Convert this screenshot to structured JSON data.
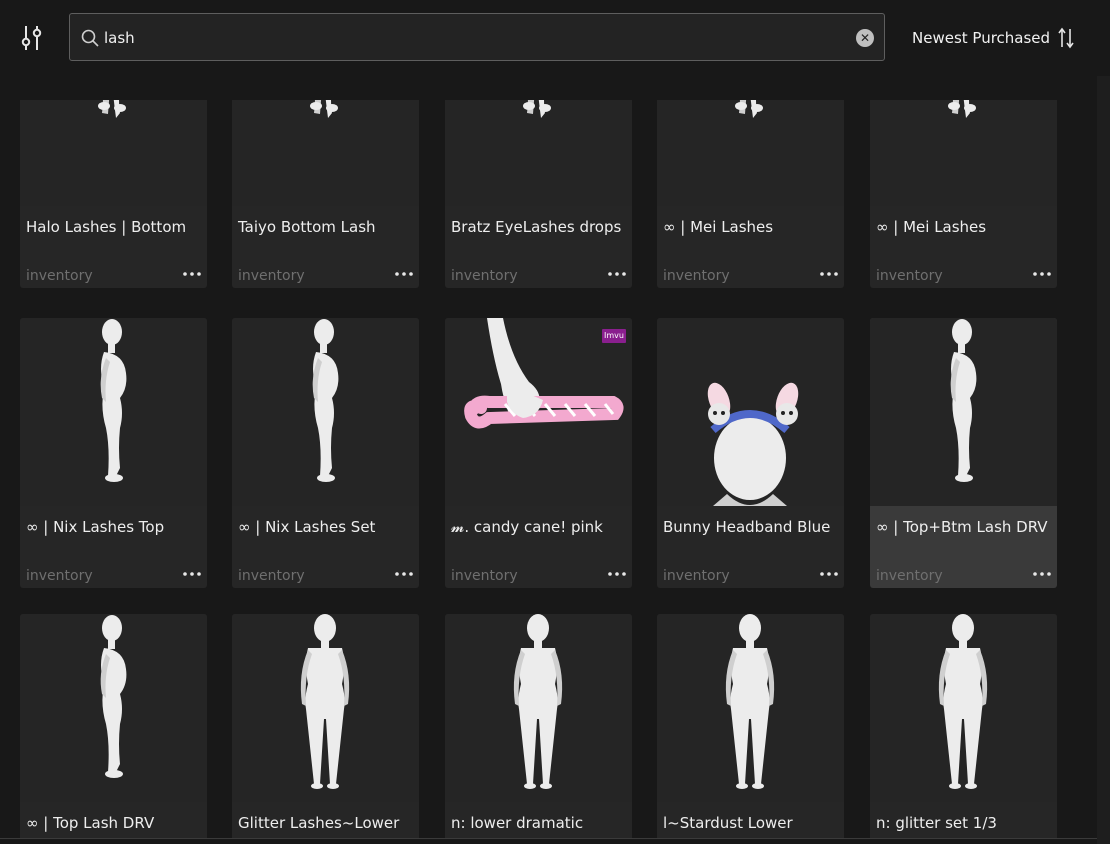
{
  "toolbar": {
    "filter_icon": "sliders-icon",
    "search": {
      "value": "lash",
      "placeholder": "",
      "icon": "search-icon",
      "clear_icon": "close-circle-icon"
    },
    "sort": {
      "label": "Newest Purchased",
      "icon": "sort-arrows-icon"
    }
  },
  "colors": {
    "background": "#181818",
    "card": "#262626",
    "card_highlight": "#3a3a3a",
    "secondary_text": "#6f6f6f",
    "badge": "#8a1f8e"
  },
  "badge_text": "Imvu",
  "items": [
    {
      "name": "Halo Lashes | Bottom",
      "location": "inventory",
      "thumb": "avatar-legs"
    },
    {
      "name": "Taiyo Bottom Lash",
      "location": "inventory",
      "thumb": "avatar-legs"
    },
    {
      "name": "Bratz EyeLashes drops",
      "location": "inventory",
      "thumb": "avatar-legs"
    },
    {
      "name": "∞ | Mei Lashes",
      "location": "inventory",
      "thumb": "avatar-legs"
    },
    {
      "name": "∞ | Mei Lashes",
      "location": "inventory",
      "thumb": "avatar-legs"
    },
    {
      "name": "∞ | Nix Lashes Top",
      "location": "inventory",
      "thumb": "avatar-side"
    },
    {
      "name": "∞ | Nix Lashes Set",
      "location": "inventory",
      "thumb": "avatar-side"
    },
    {
      "name": "𝓶. candy cane! pink",
      "location": "inventory",
      "thumb": "candy-cane"
    },
    {
      "name": "Bunny Headband Blue",
      "location": "inventory",
      "thumb": "bunny-headband"
    },
    {
      "name": "∞ | Top+Btm Lash DRV",
      "location": "inventory",
      "thumb": "avatar-side"
    },
    {
      "name": "∞ | Top Lash DRV",
      "location": "inventory",
      "thumb": "avatar-side"
    },
    {
      "name": "Glitter Lashes~Lower",
      "location": "inventory",
      "thumb": "avatar-front"
    },
    {
      "name": "n: lower dramatic lashes",
      "location": "inventory",
      "thumb": "avatar-front"
    },
    {
      "name": "l~Stardust Lower Lashes",
      "location": "inventory",
      "thumb": "avatar-front"
    },
    {
      "name": "n: glitter set 1/3",
      "location": "inventory",
      "thumb": "avatar-front"
    }
  ]
}
